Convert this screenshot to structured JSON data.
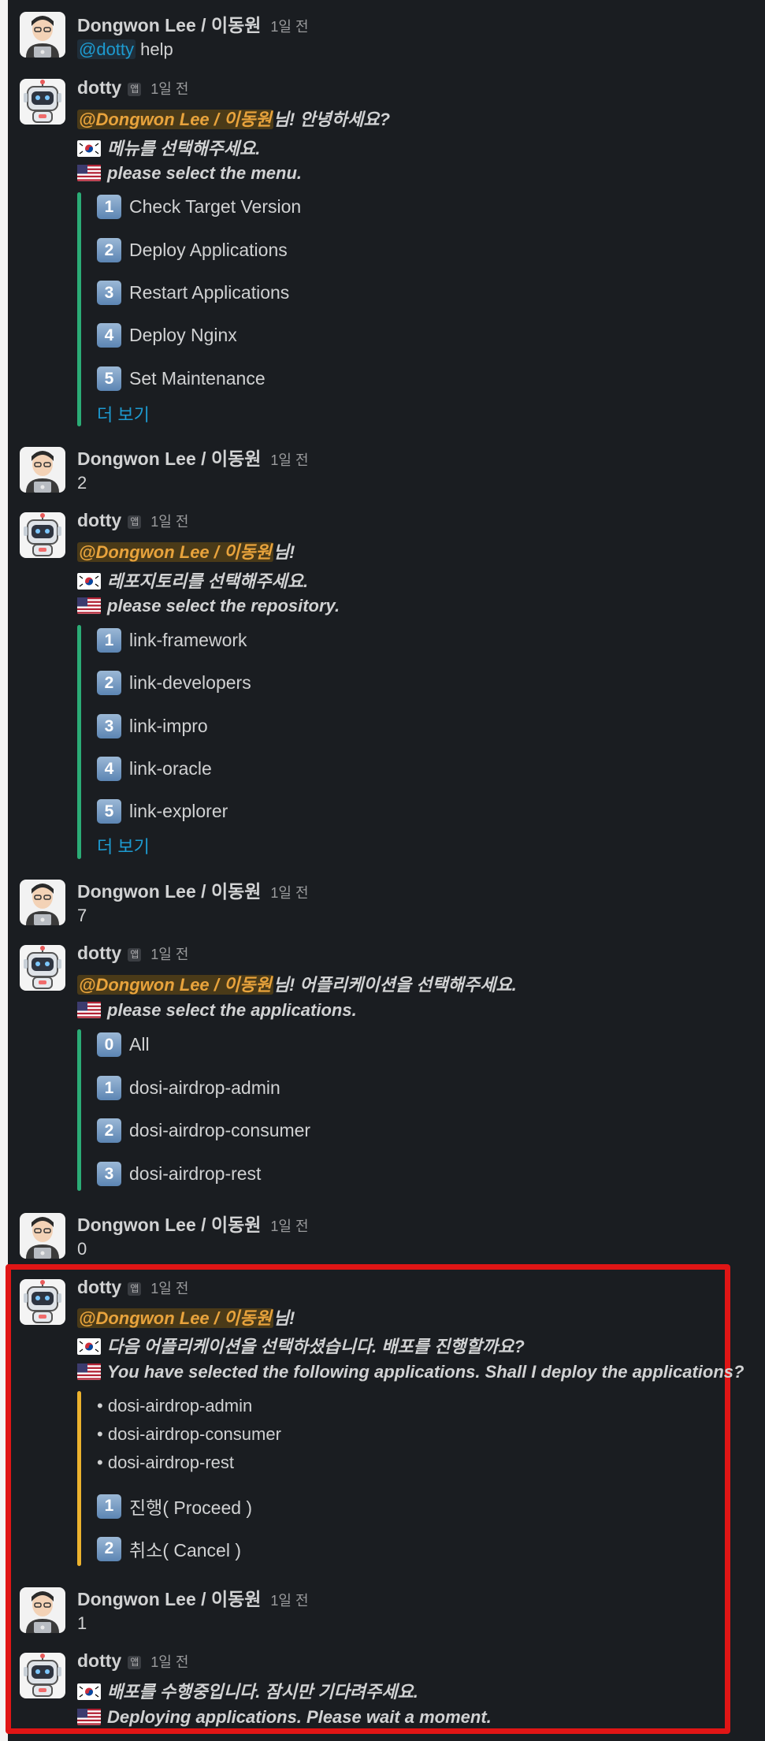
{
  "user_name": "Dongwon Lee / 이동원",
  "bot_name": "dotty",
  "app_badge": "앱",
  "timestamp": "1일 전",
  "more_label": "더 보기",
  "accent_colors": {
    "green_bar": "#2bac76",
    "yellow_bar": "#ecb22e",
    "highlight_box": "#e01515",
    "link": "#1d9bd1"
  },
  "messages": [
    {
      "author": "user",
      "mention": "@dotty",
      "text": "help"
    },
    {
      "author": "bot",
      "mention": "@Dongwon Lee / 이동원",
      "after_mention": "님! 안녕하세요?",
      "ko": "메뉴를 선택해주세요.",
      "en": "please select the menu.",
      "options": [
        {
          "num": "1",
          "label": "Check Target Version"
        },
        {
          "num": "2",
          "label": "Deploy Applications"
        },
        {
          "num": "3",
          "label": "Restart Applications"
        },
        {
          "num": "4",
          "label": "Deploy Nginx"
        },
        {
          "num": "5",
          "label": "Set Maintenance"
        }
      ]
    },
    {
      "author": "user",
      "text": "2"
    },
    {
      "author": "bot",
      "mention": "@Dongwon Lee / 이동원",
      "after_mention": "님!",
      "ko": "레포지토리를 선택해주세요.",
      "en": "please select the repository.",
      "options": [
        {
          "num": "1",
          "label": "link-framework"
        },
        {
          "num": "2",
          "label": "link-developers"
        },
        {
          "num": "3",
          "label": "link-impro"
        },
        {
          "num": "4",
          "label": "link-oracle"
        },
        {
          "num": "5",
          "label": "link-explorer"
        }
      ]
    },
    {
      "author": "user",
      "text": "7"
    },
    {
      "author": "bot",
      "mention": "@Dongwon Lee / 이동원",
      "after_mention": "님! 어플리케이션을 선택해주세요.",
      "en": "please select the applications.",
      "options": [
        {
          "num": "0",
          "label": "All"
        },
        {
          "num": "1",
          "label": "dosi-airdrop-admin"
        },
        {
          "num": "2",
          "label": "dosi-airdrop-consumer"
        },
        {
          "num": "3",
          "label": "dosi-airdrop-rest"
        }
      ]
    },
    {
      "author": "user",
      "text": "0"
    },
    {
      "author": "bot",
      "mention": "@Dongwon Lee / 이동원",
      "after_mention": "님!",
      "ko": "다음 어플리케이션을 선택하셨습니다. 배포를 진행할까요?",
      "en": "You have selected the following applications. Shall I deploy the applications?",
      "bullets": [
        "dosi-airdrop-admin",
        "dosi-airdrop-consumer",
        "dosi-airdrop-rest"
      ],
      "options": [
        {
          "num": "1",
          "label": "진행( Proceed )"
        },
        {
          "num": "2",
          "label": "취소( Cancel )"
        }
      ]
    },
    {
      "author": "user",
      "text": "1"
    },
    {
      "author": "bot",
      "ko": "배포를 수행중입니다. 잠시만 기다려주세요.",
      "en": "Deploying applications. Please wait a moment."
    }
  ]
}
